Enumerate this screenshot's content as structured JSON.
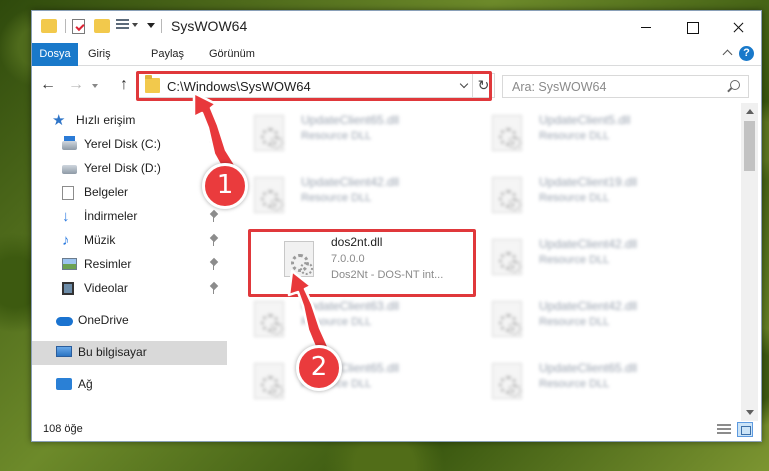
{
  "window": {
    "title": "SysWOW64"
  },
  "ribbon": {
    "tabs": [
      "Dosya",
      "Giriş",
      "Paylaş",
      "Görünüm"
    ],
    "help_label": "?"
  },
  "nav": {
    "back_glyph": "←",
    "forward_glyph": "→",
    "up_glyph": "↑",
    "refresh_glyph": "↻",
    "address": "C:\\Windows\\SysWOW64",
    "search_placeholder": "Ara: SysWOW64"
  },
  "sidebar": {
    "items": [
      {
        "label": "Hızlı erişim",
        "icon": "star-icon"
      },
      {
        "label": "Yerel Disk (C:)",
        "icon": "drive-icon"
      },
      {
        "label": "Yerel Disk (D:)",
        "icon": "drive-icon"
      },
      {
        "label": "Belgeler",
        "icon": "documents-icon"
      },
      {
        "label": "İndirmeler",
        "icon": "downloads-icon"
      },
      {
        "label": "Müzik",
        "icon": "music-icon"
      },
      {
        "label": "Resimler",
        "icon": "pictures-icon"
      },
      {
        "label": "Videolar",
        "icon": "videos-icon"
      },
      {
        "label": "OneDrive",
        "icon": "onedrive-icon"
      },
      {
        "label": "Bu bilgisayar",
        "icon": "this-pc-icon"
      },
      {
        "label": "Ağ",
        "icon": "network-icon"
      }
    ]
  },
  "files": {
    "left": [
      {
        "name": "UpdateClient65.dll",
        "sub": "Resource DLL"
      },
      {
        "name": "UpdateClient42.dll",
        "sub": "Resource DLL"
      },
      {
        "name": "dos2nt.dll",
        "sub": "7.0.0.0",
        "sub2": "Dos2Nt - DOS-NT int..."
      },
      {
        "name": "UpdateClient63.dll",
        "sub": "Resource DLL"
      },
      {
        "name": "UpdateClient65.dll",
        "sub": "Resource DLL"
      }
    ],
    "right": [
      {
        "name": "UpdateClient5.dll",
        "sub": "Resource DLL"
      },
      {
        "name": "UpdateClient19.dll",
        "sub": "Resource DLL"
      },
      {
        "name": "UpdateClient42.dll",
        "sub": "Resource DLL"
      },
      {
        "name": "UpdateClient42.dll",
        "sub": "Resource DLL"
      },
      {
        "name": "UpdateClient65.dll",
        "sub": "Resource DLL"
      }
    ]
  },
  "status": {
    "item_count": "108 öğe"
  },
  "annotations": {
    "step1": "1",
    "step2": "2",
    "highlight_color": "#e0383b"
  },
  "colors": {
    "accent": "#1979ca"
  }
}
